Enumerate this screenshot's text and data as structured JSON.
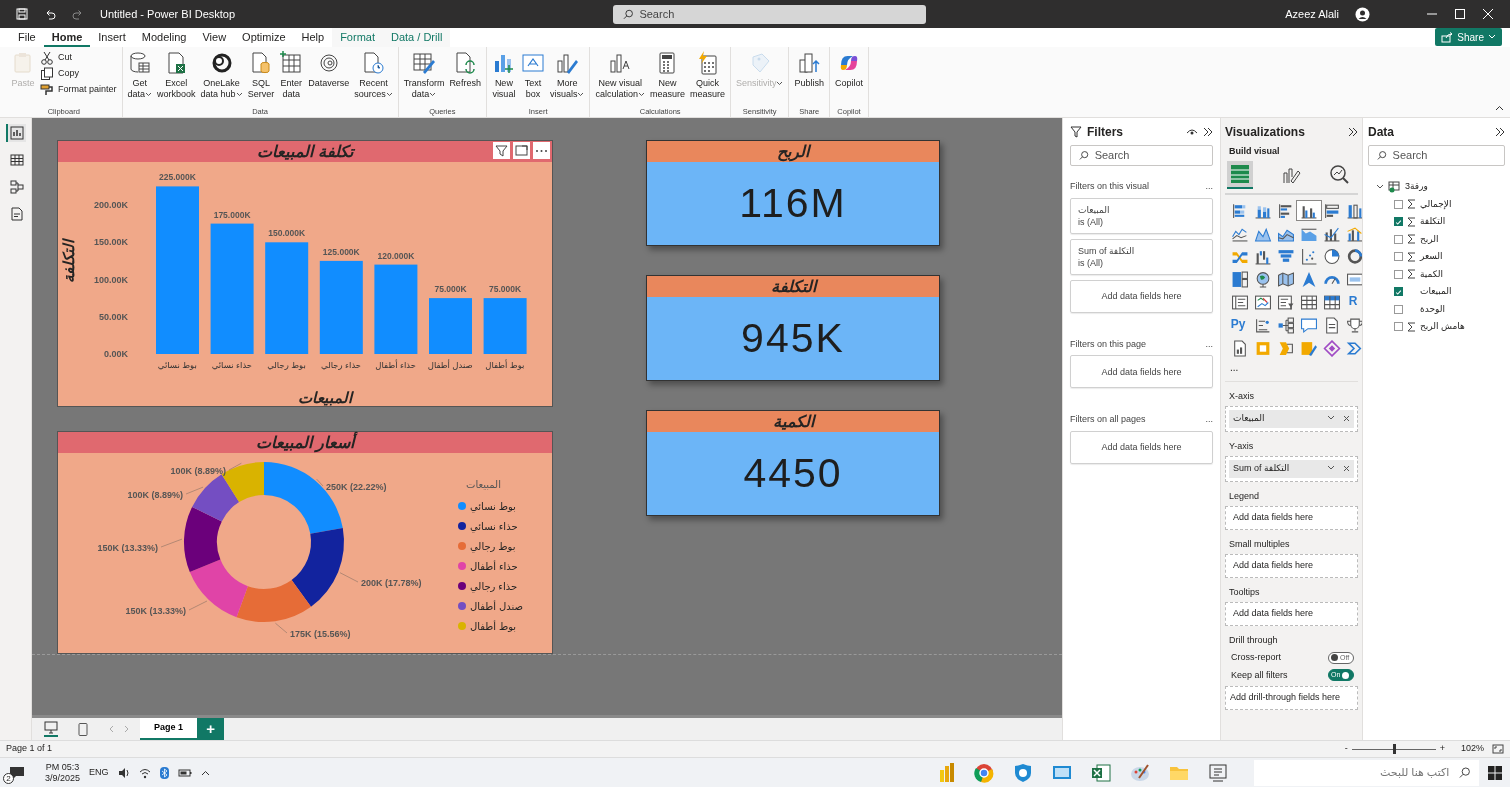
{
  "window": {
    "title": "Untitled - Power BI Desktop",
    "search_placeholder": "Search",
    "user": "Azeez Alali"
  },
  "menu_tabs": [
    {
      "label": "File",
      "selected": false,
      "contextual": false
    },
    {
      "label": "Home",
      "selected": true,
      "contextual": false
    },
    {
      "label": "Insert",
      "selected": false,
      "contextual": false
    },
    {
      "label": "Modeling",
      "selected": false,
      "contextual": false
    },
    {
      "label": "View",
      "selected": false,
      "contextual": false
    },
    {
      "label": "Optimize",
      "selected": false,
      "contextual": false
    },
    {
      "label": "Help",
      "selected": false,
      "contextual": false
    },
    {
      "label": "Format",
      "selected": false,
      "contextual": true
    },
    {
      "label": "Data / Drill",
      "selected": false,
      "contextual": true
    }
  ],
  "share_button": "Share",
  "ribbon": [
    {
      "label": "Clipboard",
      "buttons": [
        {
          "kind": "large",
          "lines": [
            "Paste"
          ],
          "dropdown": false,
          "disabled": true
        },
        {
          "kind": "small",
          "lines": [
            "Cut"
          ],
          "dropdown": false,
          "disabled": false
        },
        {
          "kind": "small",
          "lines": [
            "Copy"
          ],
          "dropdown": false,
          "disabled": false
        },
        {
          "kind": "small",
          "lines": [
            "Format painter"
          ],
          "dropdown": false,
          "disabled": false
        }
      ]
    },
    {
      "label": "Data",
      "buttons": [
        {
          "kind": "large",
          "lines": [
            "Get",
            "data"
          ],
          "dropdown": true,
          "disabled": false
        },
        {
          "kind": "large",
          "lines": [
            "Excel",
            "workbook"
          ],
          "dropdown": false,
          "disabled": false
        },
        {
          "kind": "large",
          "lines": [
            "OneLake",
            "data hub"
          ],
          "dropdown": true,
          "disabled": false
        },
        {
          "kind": "large",
          "lines": [
            "SQL",
            "Server"
          ],
          "dropdown": false,
          "disabled": false
        },
        {
          "kind": "large",
          "lines": [
            "Enter",
            "data"
          ],
          "dropdown": false,
          "disabled": false
        },
        {
          "kind": "large",
          "lines": [
            "Dataverse"
          ],
          "dropdown": false,
          "disabled": false
        },
        {
          "kind": "large",
          "lines": [
            "Recent",
            "sources"
          ],
          "dropdown": true,
          "disabled": false
        }
      ]
    },
    {
      "label": "Queries",
      "buttons": [
        {
          "kind": "large",
          "lines": [
            "Transform",
            "data"
          ],
          "dropdown": true,
          "disabled": false
        },
        {
          "kind": "large",
          "lines": [
            "Refresh"
          ],
          "dropdown": false,
          "disabled": false
        }
      ]
    },
    {
      "label": "Insert",
      "buttons": [
        {
          "kind": "large",
          "lines": [
            "New",
            "visual"
          ],
          "dropdown": false,
          "disabled": false
        },
        {
          "kind": "large",
          "lines": [
            "Text",
            "box"
          ],
          "dropdown": false,
          "disabled": false
        },
        {
          "kind": "large",
          "lines": [
            "More",
            "visuals"
          ],
          "dropdown": true,
          "disabled": false
        }
      ]
    },
    {
      "label": "Calculations",
      "buttons": [
        {
          "kind": "large",
          "lines": [
            "New visual",
            "calculation"
          ],
          "dropdown": true,
          "disabled": false
        },
        {
          "kind": "large",
          "lines": [
            "New",
            "measure"
          ],
          "dropdown": false,
          "disabled": false
        },
        {
          "kind": "large",
          "lines": [
            "Quick",
            "measure"
          ],
          "dropdown": false,
          "disabled": false
        }
      ]
    },
    {
      "label": "Sensitivity",
      "buttons": [
        {
          "kind": "large",
          "lines": [
            "Sensitivity"
          ],
          "dropdown": true,
          "disabled": true
        }
      ]
    },
    {
      "label": "Share",
      "buttons": [
        {
          "kind": "large",
          "lines": [
            "Publish"
          ],
          "dropdown": false,
          "disabled": false
        }
      ]
    },
    {
      "label": "Copilot",
      "buttons": [
        {
          "kind": "large",
          "lines": [
            "Copilot"
          ],
          "dropdown": false,
          "disabled": false
        }
      ]
    }
  ],
  "views": [
    {
      "selected": true
    },
    {
      "selected": false
    },
    {
      "selected": false
    },
    {
      "selected": false
    }
  ],
  "bar_visual": {
    "title": "تكلفة المبيعات",
    "chart_data": {
      "type": "bar",
      "xlabel": "المبيعات",
      "ylabel": "التكلفة",
      "categories": [
        "بوط نسائي",
        "حذاء نسائي",
        "بوط رجالي",
        "حذاء رجالي",
        "حذاء أطفال",
        "صندل أطفال",
        "بوط أطفال"
      ],
      "values": [
        225000,
        175000,
        150000,
        125000,
        120000,
        75000,
        75000
      ],
      "ylim": [
        0,
        225000
      ],
      "yticks": [
        {
          "value": 0,
          "label": "0.00K"
        },
        {
          "value": 50000,
          "label": "50.00K"
        },
        {
          "value": 100000,
          "label": "100.00K"
        },
        {
          "value": 150000,
          "label": "150.00K"
        },
        {
          "value": 200000,
          "label": "200.00K"
        }
      ],
      "value_labels": [
        "225.000K",
        "175.000K",
        "150.000K",
        "125.000K",
        "120.000K",
        "75.000K",
        "75.000K"
      ]
    }
  },
  "donut_visual": {
    "title": "أسعار المبيعات",
    "chart_data": {
      "type": "donut",
      "categories": [
        "بوط نسائي",
        "حذاء نسائي",
        "بوط رجالي",
        "حذاء أطفال",
        "حذاء رجالي",
        "صندل أطفال",
        "بوط أطفال"
      ],
      "values": [
        250000,
        200000,
        175000,
        150000,
        150000,
        100000,
        100000
      ],
      "value_labels": [
        "250K (22.22%)",
        "200K (17.78%)",
        "175K (15.56%)",
        "150K (13.33%)",
        "150K (13.33%)",
        "100K (8.89%)",
        "100K (8.89%)"
      ]
    },
    "legend": {
      "title": "المبيعات",
      "items": [
        {
          "color": "#118dff"
        },
        {
          "color": "#12239e"
        },
        {
          "color": "#e66c37"
        },
        {
          "color": "#e044a7"
        },
        {
          "color": "#6b007b"
        },
        {
          "color": "#744ec2"
        },
        {
          "color": "#d9b300"
        }
      ]
    }
  },
  "kpis": [
    {
      "title": "الربح",
      "value": "116M"
    },
    {
      "title": "التكلفة",
      "value": "945K"
    },
    {
      "title": "الكمية",
      "value": "4450"
    }
  ],
  "filters": {
    "title": "Filters",
    "search_placeholder": "Search",
    "sections": [
      {
        "title": "Filters on this visual",
        "more": "...",
        "cards": [
          {
            "kind": "filter",
            "field": "المبيعات",
            "state": "is (All)"
          },
          {
            "kind": "filter",
            "field": "Sum of التكلفة",
            "state": "is (All)"
          },
          {
            "kind": "drop",
            "text": "Add data fields here"
          }
        ]
      },
      {
        "title": "Filters on this page",
        "more": "...",
        "cards": [
          {
            "kind": "drop",
            "text": "Add data fields here"
          }
        ]
      },
      {
        "title": "Filters on all pages",
        "more": "...",
        "cards": [
          {
            "kind": "drop",
            "text": "Add data fields here"
          }
        ]
      }
    ]
  },
  "visualizations": {
    "title": "Visualizations",
    "subtitle": "Build visual",
    "tabs": [
      {
        "selected": true
      },
      {
        "selected": false
      },
      {
        "selected": false
      }
    ],
    "gallery": [
      {
        "selected": false
      },
      {
        "selected": false
      },
      {
        "selected": false
      },
      {
        "selected": true
      },
      {
        "selected": false
      },
      {
        "selected": false
      },
      {
        "selected": false
      },
      {
        "selected": false
      },
      {
        "selected": false
      },
      {
        "selected": false
      },
      {
        "selected": false
      },
      {
        "selected": false
      },
      {
        "selected": false
      },
      {
        "selected": false
      },
      {
        "selected": false
      },
      {
        "selected": false
      },
      {
        "selected": false
      },
      {
        "selected": false
      },
      {
        "selected": false
      },
      {
        "selected": false
      },
      {
        "selected": false
      },
      {
        "selected": false
      },
      {
        "selected": false
      },
      {
        "selected": false
      },
      {
        "selected": false
      },
      {
        "selected": false
      },
      {
        "selected": false
      },
      {
        "selected": false
      },
      {
        "selected": false
      },
      {
        "selected": false,
        "label": "R"
      },
      {
        "selected": false,
        "label": "Py"
      },
      {
        "selected": false
      },
      {
        "selected": false
      },
      {
        "selected": false
      },
      {
        "selected": false
      },
      {
        "selected": false
      },
      {
        "selected": false
      },
      {
        "selected": false
      },
      {
        "selected": false
      },
      {
        "selected": false
      },
      {
        "selected": false
      },
      {
        "selected": false
      }
    ],
    "more": "...",
    "wells": [
      {
        "label": "X-axis",
        "kind": "field",
        "value": "المبيعات"
      },
      {
        "label": "Y-axis",
        "kind": "field",
        "value": "Sum of التكلفة"
      },
      {
        "label": "Legend",
        "kind": "drop",
        "value": "Add data fields here"
      },
      {
        "label": "Small multiples",
        "kind": "drop",
        "value": "Add data fields here"
      },
      {
        "label": "Tooltips",
        "kind": "drop",
        "value": "Add data fields here"
      }
    ],
    "drill": {
      "title": "Drill through",
      "toggles": [
        {
          "label": "Cross-report",
          "on": false,
          "text": "Off"
        },
        {
          "label": "Keep all filters",
          "on": true,
          "text": "On"
        }
      ],
      "drop": "Add drill-through fields here"
    }
  },
  "data": {
    "title": "Data",
    "search_placeholder": "Search",
    "tables": [
      {
        "label": "ورقة3",
        "expanded": true,
        "children": [
          {
            "label": "الإجمالي",
            "kind": "sum",
            "checked": false
          },
          {
            "label": "التكلفة",
            "kind": "sum",
            "checked": true
          },
          {
            "label": "الربح",
            "kind": "sum",
            "checked": false
          },
          {
            "label": "السعر",
            "kind": "sum",
            "checked": false
          },
          {
            "label": "الكمية",
            "kind": "sum",
            "checked": false
          },
          {
            "label": "المبيعات",
            "kind": "text",
            "checked": true
          },
          {
            "label": "الوحدة",
            "kind": "text",
            "checked": false
          },
          {
            "label": "هامش الربح",
            "kind": "sum",
            "checked": false
          }
        ]
      }
    ]
  },
  "pages": {
    "views": [
      {
        "selected": true
      },
      {
        "selected": false
      }
    ],
    "tabs": [
      {
        "label": "Page 1",
        "selected": true
      }
    ],
    "add": "+"
  },
  "status": {
    "page_info": "Page 1 of 1",
    "zoom_minus": "-",
    "zoom_plus": "+",
    "zoom_slider": {
      "level": 0.5
    },
    "zoom": "102%"
  },
  "taskbar": {
    "badge": "2",
    "time": "PM 05:3",
    "date": "3/9/2025",
    "language": "ENG",
    "search_placeholder": "اكتب هنا للبحث"
  }
}
